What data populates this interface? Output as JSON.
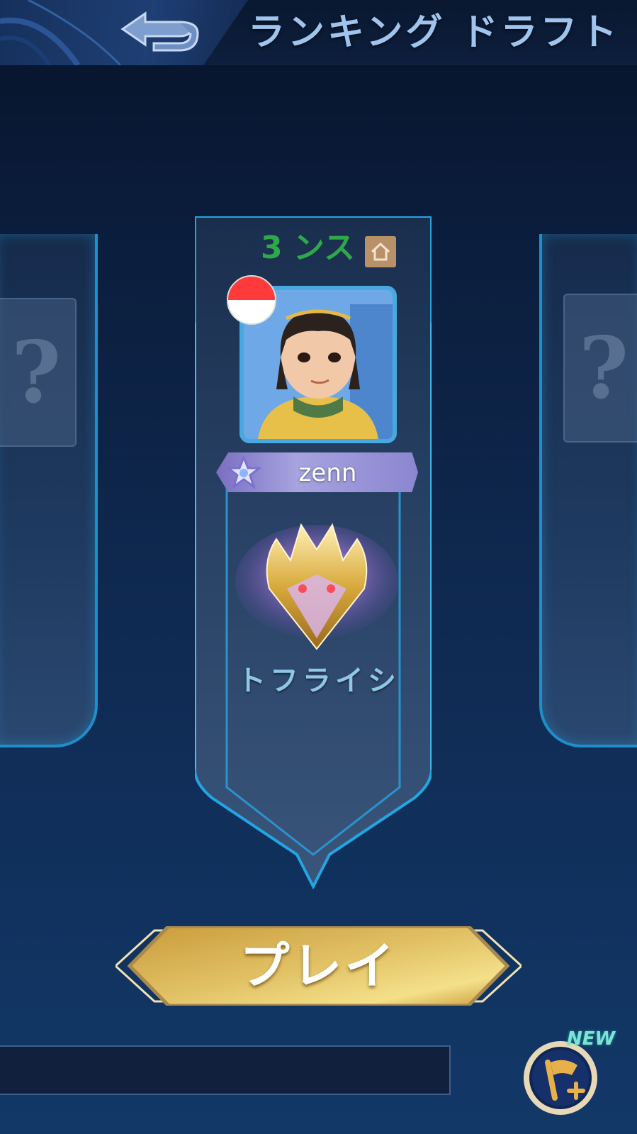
{
  "header": {
    "title": "ランキング ドラフト",
    "back_icon": "back-arrow-icon"
  },
  "left_slot": {
    "placeholder": "?"
  },
  "right_slot": {
    "placeholder": "?"
  },
  "player_card": {
    "position_label": "3 ンス",
    "home_icon": "home-icon",
    "flag_icon": "indonesia-flag-icon",
    "avatar": "player-avatar",
    "star_icon": "star-icon",
    "name": "zenn",
    "rank_emblem": "mythic-rank-emblem",
    "rank_name": "トフライシ"
  },
  "actions": {
    "play_label": "プレイ",
    "flag_button_icon": "flag-plus-icon",
    "new_badge": "NEW"
  },
  "colors": {
    "position_label": "#2fa84a",
    "accent_blue": "#1f8ec9",
    "play_gold": "#d8b553"
  }
}
